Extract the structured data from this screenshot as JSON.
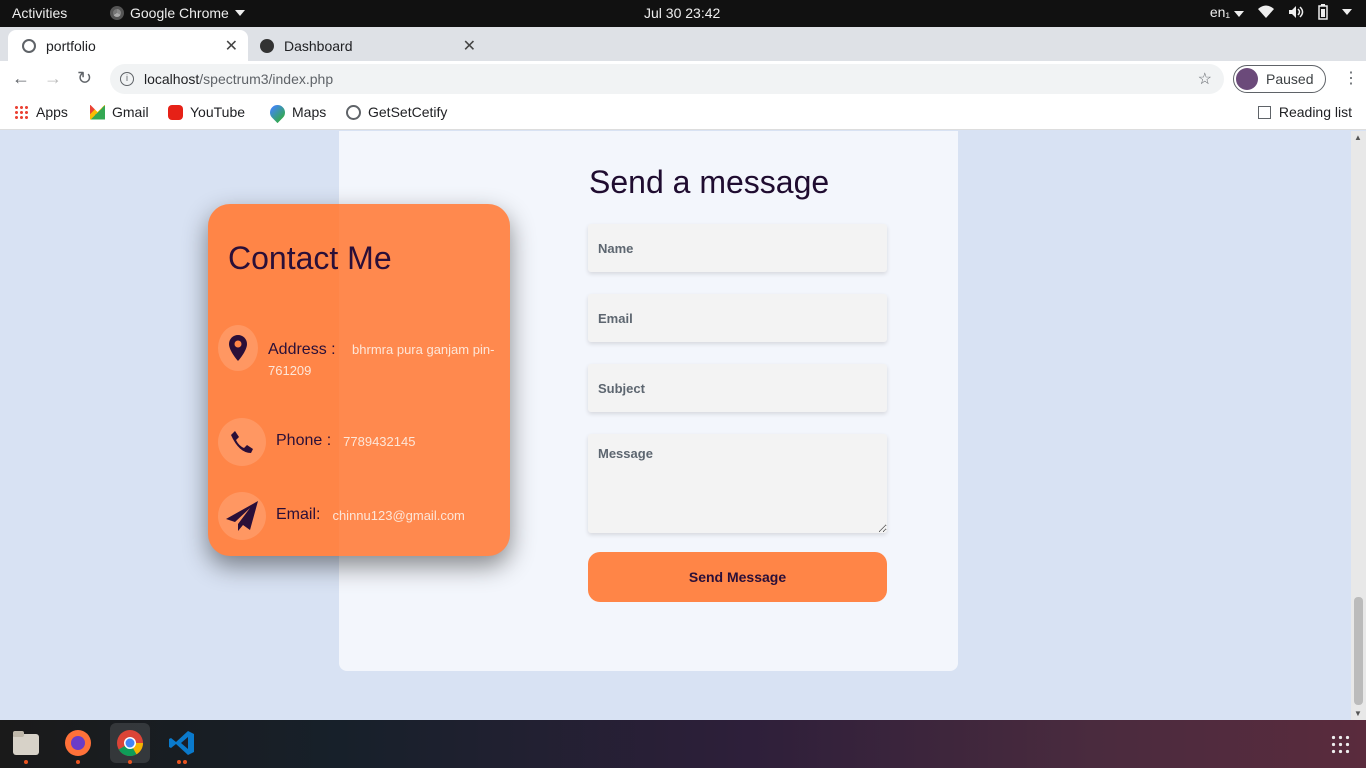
{
  "system_bar": {
    "activities": "Activities",
    "app_name": "Google Chrome",
    "clock": "Jul 30  23:42",
    "keyboard_layout": "en₁"
  },
  "tabs": [
    {
      "title": "portfolio",
      "active": true
    },
    {
      "title": "Dashboard",
      "active": false
    }
  ],
  "toolbar": {
    "url_host": "localhost",
    "url_path": "/spectrum3/index.php",
    "profile_status": "Paused"
  },
  "bookmarks": [
    {
      "label": "Apps",
      "icon": "apps-grid-icon"
    },
    {
      "label": "Gmail",
      "icon": "gmail-icon"
    },
    {
      "label": "YouTube",
      "icon": "youtube-icon"
    },
    {
      "label": "Maps",
      "icon": "maps-icon"
    },
    {
      "label": "GetSetCetify",
      "icon": "globe-icon"
    }
  ],
  "reading_list": "Reading list",
  "contact_card": {
    "title": "Contact Me",
    "address_label": "Address :",
    "address_value": "bhrmra pura ganjam pin-761209",
    "phone_label": "Phone :",
    "phone_value": "7789432145",
    "email_label": "Email:",
    "email_value": "chinnu123@gmail.com"
  },
  "form": {
    "title": "Send a message",
    "name_placeholder": "Name",
    "email_placeholder": "Email",
    "subject_placeholder": "Subject",
    "message_placeholder": "Message",
    "submit_label": "Send Message"
  },
  "colors": {
    "accent": "#ff8547",
    "page_bg": "#d8e2f3",
    "text_dark": "#2a0f38"
  },
  "dock_apps": [
    "files-icon",
    "firefox-icon",
    "chrome-icon",
    "vscode-icon"
  ]
}
